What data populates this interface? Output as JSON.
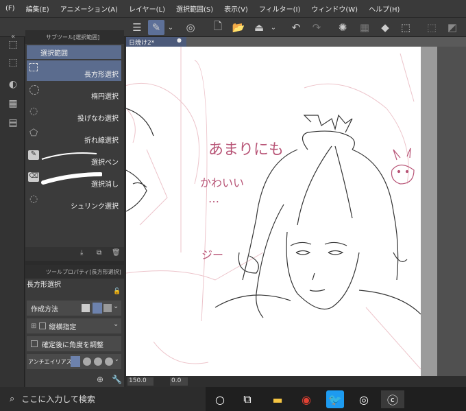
{
  "menu": [
    "(F)",
    "編集(E)",
    "アニメーション(A)",
    "レイヤー(L)",
    "選択範囲(S)",
    "表示(V)",
    "フィルター(I)",
    "ウィンドウ(W)",
    "ヘルプ(H)"
  ],
  "subtool": {
    "panel_title": "サブツール[選択範囲]",
    "group": "選択範囲",
    "items": [
      "長方形選択",
      "楕円選択",
      "投げなわ選択",
      "折れ線選択",
      "選択ペン",
      "選択消し",
      "シュリンク選択"
    ]
  },
  "props": {
    "panel_title": "ツールプロパティ[長方形選択]",
    "tool_name": "長方形選択",
    "mode_label": "作成方法",
    "aspect_label": "縦横指定",
    "angle_label": "確定後に角度を調整",
    "aa_label": "アンチエイリアス"
  },
  "canvas": {
    "tab": "日焼け2*",
    "text1": "あまりにも",
    "text2": "かわいい",
    "text3": "…",
    "text4": "ジー",
    "zoom": "150.0",
    "angle": "0.0"
  },
  "taskbar": {
    "search_placeholder": "ここに入力して検索"
  }
}
